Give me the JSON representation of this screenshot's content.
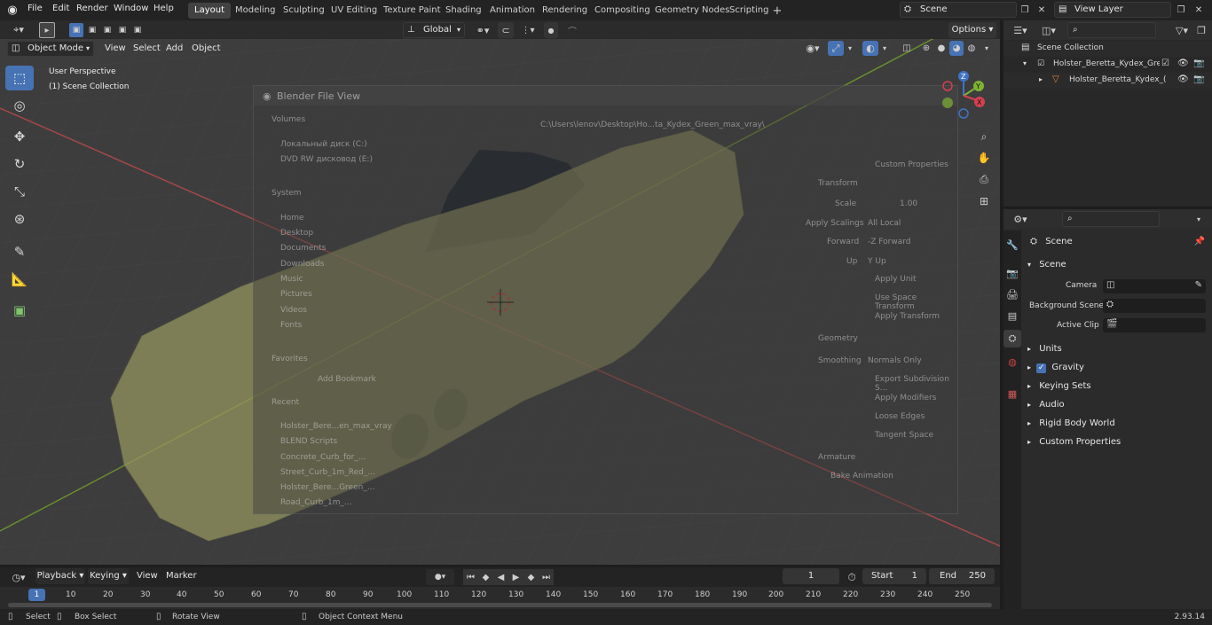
{
  "topbar": {
    "menus": [
      "File",
      "Edit",
      "Render",
      "Window",
      "Help"
    ],
    "workspaces": [
      "Layout",
      "Modeling",
      "Sculpting",
      "UV Editing",
      "Texture Paint",
      "Shading",
      "Animation",
      "Rendering",
      "Compositing",
      "Geometry Nodes",
      "Scripting"
    ],
    "active_workspace": "Layout",
    "scene": "Scene",
    "view_layer": "View Layer"
  },
  "viewport_header": {
    "mode": "Object Mode",
    "menus": [
      "View",
      "Select",
      "Add",
      "Object"
    ],
    "orientation": "Global",
    "options": "Options"
  },
  "viewport": {
    "perspective": "User Perspective",
    "collection": "(1) Scene Collection"
  },
  "file_dialog": {
    "title": "Blender File View",
    "volumes_header": "Volumes",
    "volumes": [
      "Локальный диск (C:)",
      "DVD RW дисковод (E:)"
    ],
    "system_header": "System",
    "system": [
      "Home",
      "Desktop",
      "Documents",
      "Downloads",
      "Music",
      "Pictures",
      "Videos",
      "Fonts"
    ],
    "favorites_header": "Favorites",
    "add_bookmark": "Add Bookmark",
    "recent_header": "Recent",
    "recent": [
      "Holster_Bere...en_max_vray",
      "BLEND Scripts",
      "Concrete_Curb_for_...",
      "Street_Curb_1m_Red_...",
      "Holster_Bere...Green_...",
      "Road_Curb_1m_..."
    ],
    "path": "C:\\Users\\lenov\\Desktop\\Ho...ta_Kydex_Green_max_vray\\",
    "right_panel": {
      "custom_properties": "Custom Properties",
      "transform": "Transform",
      "scale_label": "Scale",
      "scale_value": "1.00",
      "apply_scalings_label": "Apply Scalings",
      "apply_scalings_value": "All Local",
      "forward_label": "Forward",
      "forward_value": "-Z Forward",
      "up_label": "Up",
      "up_value": "Y Up",
      "apply_unit": "Apply Unit",
      "use_space_transform": "Use Space Transform",
      "apply_transform": "Apply Transform",
      "geometry": "Geometry",
      "smoothing_label": "Smoothing",
      "smoothing_value": "Normals Only",
      "export_subdivision": "Export Subdivision S...",
      "apply_modifiers": "Apply Modifiers",
      "loose_edges": "Loose Edges",
      "tangent_space": "Tangent Space",
      "armature": "Armature",
      "bake_animation": "Bake Animation"
    }
  },
  "outliner": {
    "root": "Scene Collection",
    "items": [
      "Holster_Beretta_Kydex_Greer",
      "Holster_Beretta_Kydex_("
    ]
  },
  "properties": {
    "context": "Scene",
    "section": "Scene",
    "camera_label": "Camera",
    "background_scene_label": "Background Scene",
    "active_clip_label": "Active Clip",
    "subpanels": [
      "Units",
      "Gravity",
      "Keying Sets",
      "Audio",
      "Rigid Body World",
      "Custom Properties"
    ]
  },
  "timeline": {
    "menus": [
      "Playback",
      "Keying",
      "View",
      "Marker"
    ],
    "current_frame": "1",
    "start_label": "Start",
    "start_value": "1",
    "end_label": "End",
    "end_value": "250",
    "ruler": [
      "1",
      "10",
      "20",
      "30",
      "40",
      "50",
      "60",
      "70",
      "80",
      "90",
      "100",
      "110",
      "120",
      "130",
      "140",
      "150",
      "160",
      "170",
      "180",
      "190",
      "200",
      "210",
      "220",
      "230",
      "240",
      "250"
    ]
  },
  "statusbar": {
    "select": "Select",
    "box_select": "Box Select",
    "rotate_view": "Rotate View",
    "context_menu": "Object Context Menu",
    "version": "2.93.14"
  }
}
